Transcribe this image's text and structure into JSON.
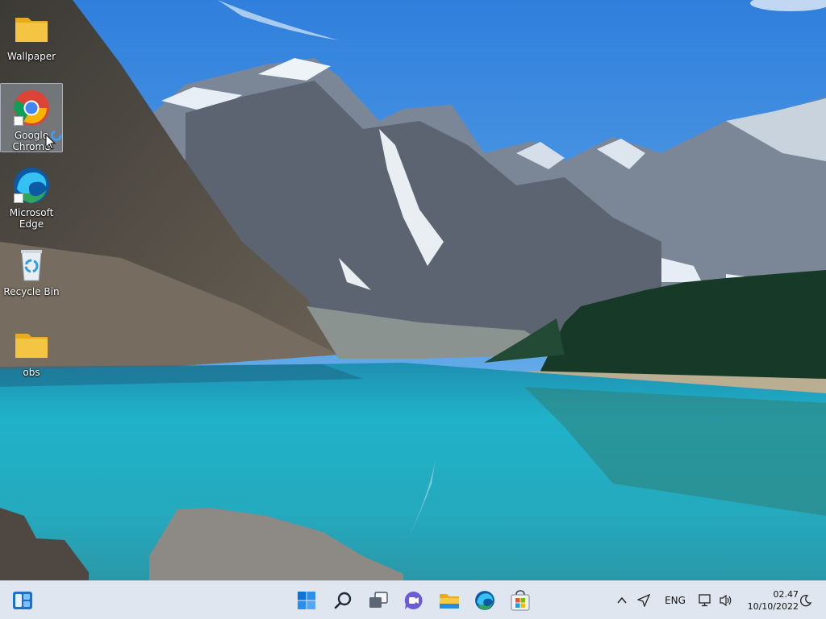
{
  "desktop": {
    "icons": [
      {
        "label": "Wallpaper",
        "icon": "folder-icon"
      },
      {
        "label": "Google Chrome",
        "icon": "chrome-icon"
      },
      {
        "label": "Microsoft Edge",
        "icon": "edge-icon"
      },
      {
        "label": "Recycle Bin",
        "icon": "recycle-bin-icon"
      },
      {
        "label": "obs",
        "icon": "folder-icon"
      }
    ]
  },
  "taskbar": {
    "widgets_icon": "widgets-icon",
    "pinned": [
      {
        "name": "start",
        "icon": "windows-logo-icon"
      },
      {
        "name": "search",
        "icon": "search-icon"
      },
      {
        "name": "task-view",
        "icon": "task-view-icon"
      },
      {
        "name": "chat",
        "icon": "teams-chat-icon"
      },
      {
        "name": "file-explorer",
        "icon": "file-explorer-icon"
      },
      {
        "name": "edge",
        "icon": "edge-icon"
      },
      {
        "name": "store",
        "icon": "microsoft-store-icon"
      }
    ],
    "tray": {
      "language": "ENG",
      "time": "02.47",
      "date": "10/10/2022"
    }
  },
  "colors": {
    "taskbar_bg": "#dfe6ef",
    "windows_blue": "#0a74da",
    "folder_yellow": "#f4c542"
  }
}
